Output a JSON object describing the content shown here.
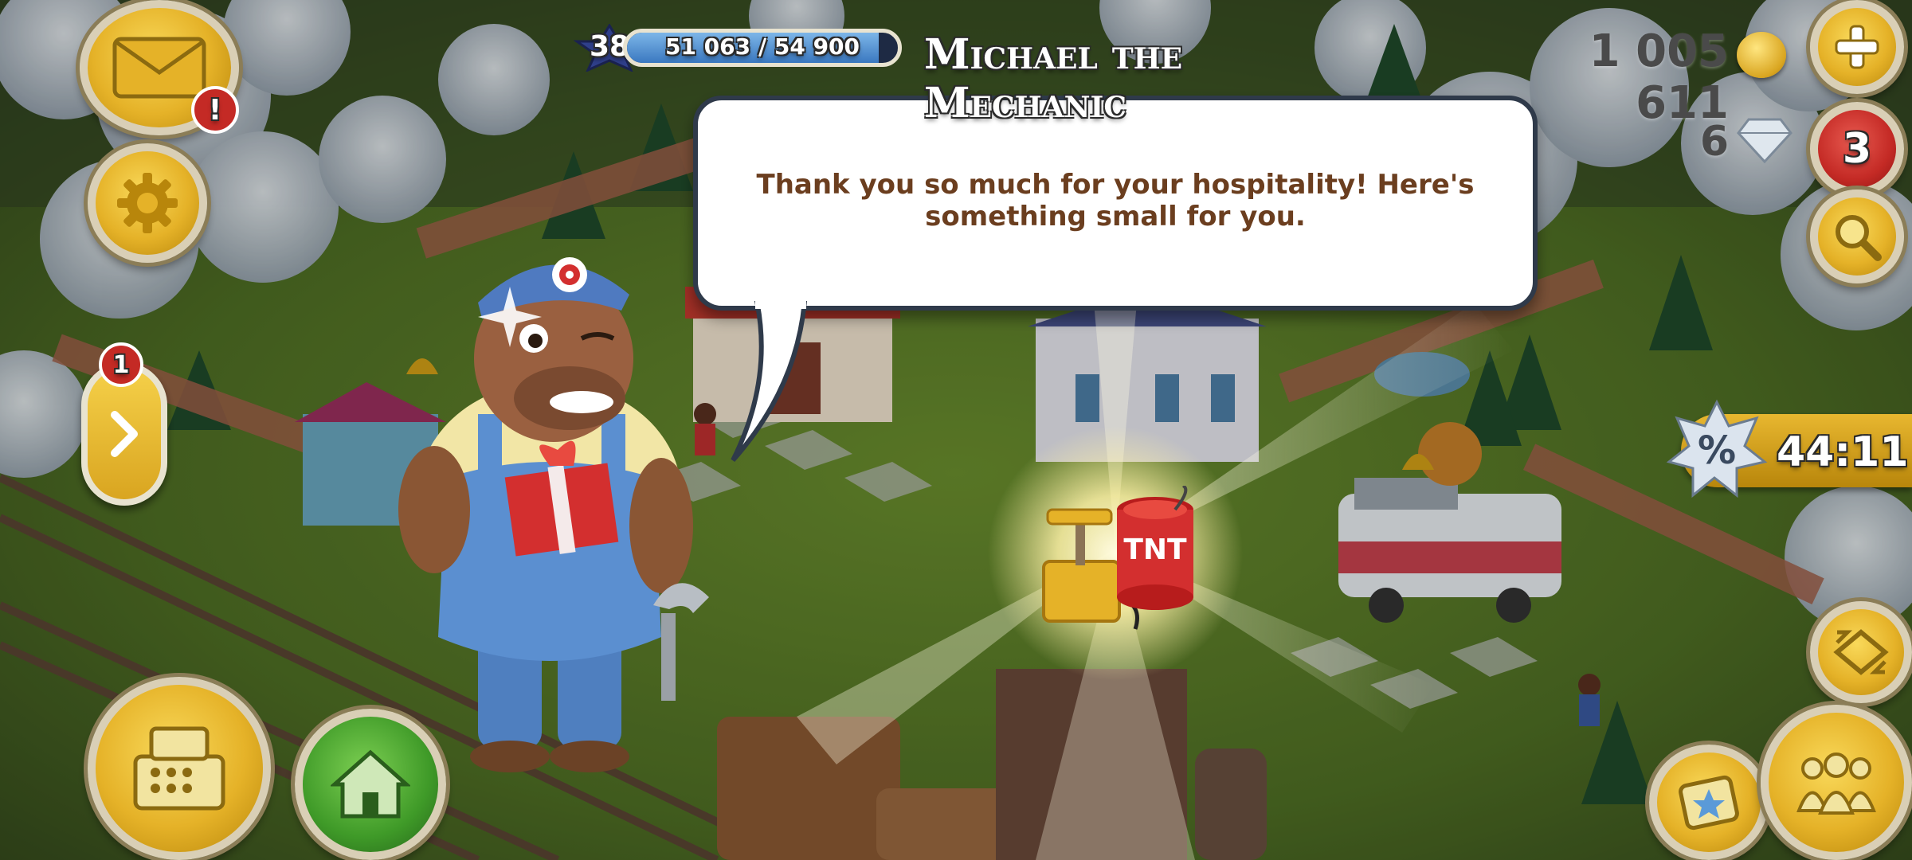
{
  "header": {
    "level": "38",
    "xp_text": "51 063 / 54 900",
    "xp_progress": 0.93,
    "character_name": "Michael the Mechanic"
  },
  "currency": {
    "coins": "1 005 611",
    "diamonds": "6"
  },
  "dialog": {
    "message": "Thank you so much for your hospitality! Here's something small for you."
  },
  "badges": {
    "mail_alert": "!",
    "magnifier_count": "3",
    "side_panel_count": "1"
  },
  "reward": {
    "icon": "tnt-detonator-icon",
    "label": "TNT"
  },
  "timer": {
    "text": "44:11",
    "icon": "discount-percent-icon"
  },
  "buttons": {
    "mail": "mail-icon",
    "settings": "gear-icon",
    "add_coins": "plus-icon",
    "diamond_shop": "magnifier-icon",
    "side_panel": "chevron-right-icon",
    "shop": "cash-register-icon",
    "home": "house-icon",
    "edit_mode": "expand-icon",
    "decorations": "star-card-icon",
    "friends": "friends-icon"
  },
  "colors": {
    "accent_gold": "#E5B228",
    "badge_red": "#C42A25",
    "home_green": "#3F9A28",
    "dialog_text": "#6B3E1F",
    "tnt_red": "#D32F2F"
  }
}
